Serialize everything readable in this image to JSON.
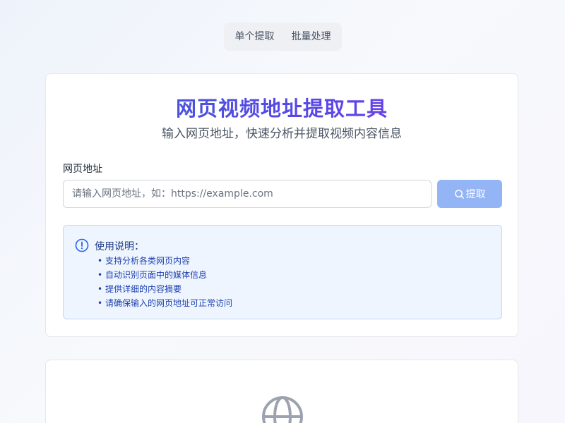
{
  "tabs": [
    {
      "label": "单个提取"
    },
    {
      "label": "批量处理"
    }
  ],
  "header": {
    "title": "网页视频地址提取工具",
    "subtitle": "输入网页地址，快速分析并提取视频内容信息"
  },
  "form": {
    "label": "网页地址",
    "url_value": "",
    "url_placeholder": "请输入网页地址，如：https://example.com",
    "submit_label": "提取",
    "submit_icon": "search-icon"
  },
  "instructions": {
    "icon": "info-icon",
    "title": "使用说明：",
    "items": [
      "支持分析各类网页内容",
      "自动识别页面中的媒体信息",
      "提供详细的内容摘要",
      "请确保输入的网页地址可正常访问"
    ]
  },
  "result": {
    "icon": "globe-icon"
  },
  "colors": {
    "accent": "#4f46e5",
    "button": "#93b4f5",
    "info_bg": "#eef5fe",
    "info_border": "#bfd8f5",
    "info_text": "#1e40af",
    "globe": "#9ca3af"
  }
}
